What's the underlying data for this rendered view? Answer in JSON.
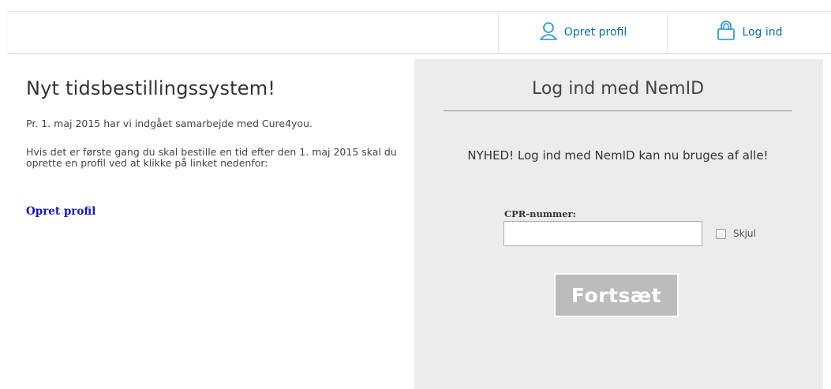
{
  "nav": {
    "create_profile": "Opret profil",
    "login": "Log ind"
  },
  "left": {
    "title": "Nyt tidsbestillingssystem!",
    "paragraph1": "Pr. 1. maj 2015 har vi indgået samarbejde med Cure4you.",
    "paragraph2": "Hvis det er første gang du skal bestille en tid efter den 1. maj 2015 skal du oprette en profil ved at klikke på linket nedenfor:",
    "link": "Opret profil"
  },
  "login_panel": {
    "title": "Log ind med NemID",
    "news": "NYHED! Log ind med NemID kan nu bruges af alle!",
    "cpr_label": "CPR-nummer:",
    "cpr_value": "",
    "hide_label": "Skjul",
    "hide_checked": false,
    "continue_button": "Fortsæt"
  },
  "colors": {
    "link_blue": "#1515c8",
    "nav_blue": "#0a6cb3",
    "panel_bg": "#ececec",
    "button_bg": "#bcbcbc"
  },
  "icons": {
    "create_profile": "user-icon",
    "login": "lock-icon"
  }
}
